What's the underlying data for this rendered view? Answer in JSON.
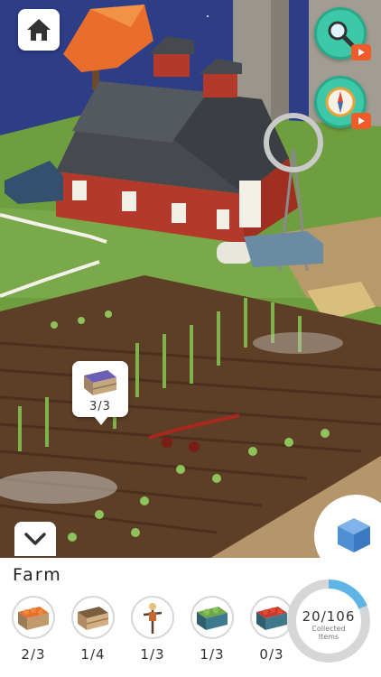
{
  "panel": {
    "title": "Farm"
  },
  "bubble": {
    "count": "3/3",
    "icon": "crate-icon"
  },
  "items": [
    {
      "name": "crate-carrots",
      "count": "2/3"
    },
    {
      "name": "crate-empty",
      "count": "1/4"
    },
    {
      "name": "scarecrow",
      "count": "1/3"
    },
    {
      "name": "crate-cabbage",
      "count": "1/3"
    },
    {
      "name": "crate-tomatoes",
      "count": "0/3"
    }
  ],
  "progress": {
    "value": "20/106",
    "label_line1": "Collected",
    "label_line2": "Items",
    "fraction": 0.1887,
    "color": "#5fb4e6"
  },
  "buttons": {
    "home": "home-icon",
    "search": "magnifier-icon",
    "compass": "compass-icon",
    "collapse": "chevron-down-icon",
    "cube": "cube-icon"
  }
}
